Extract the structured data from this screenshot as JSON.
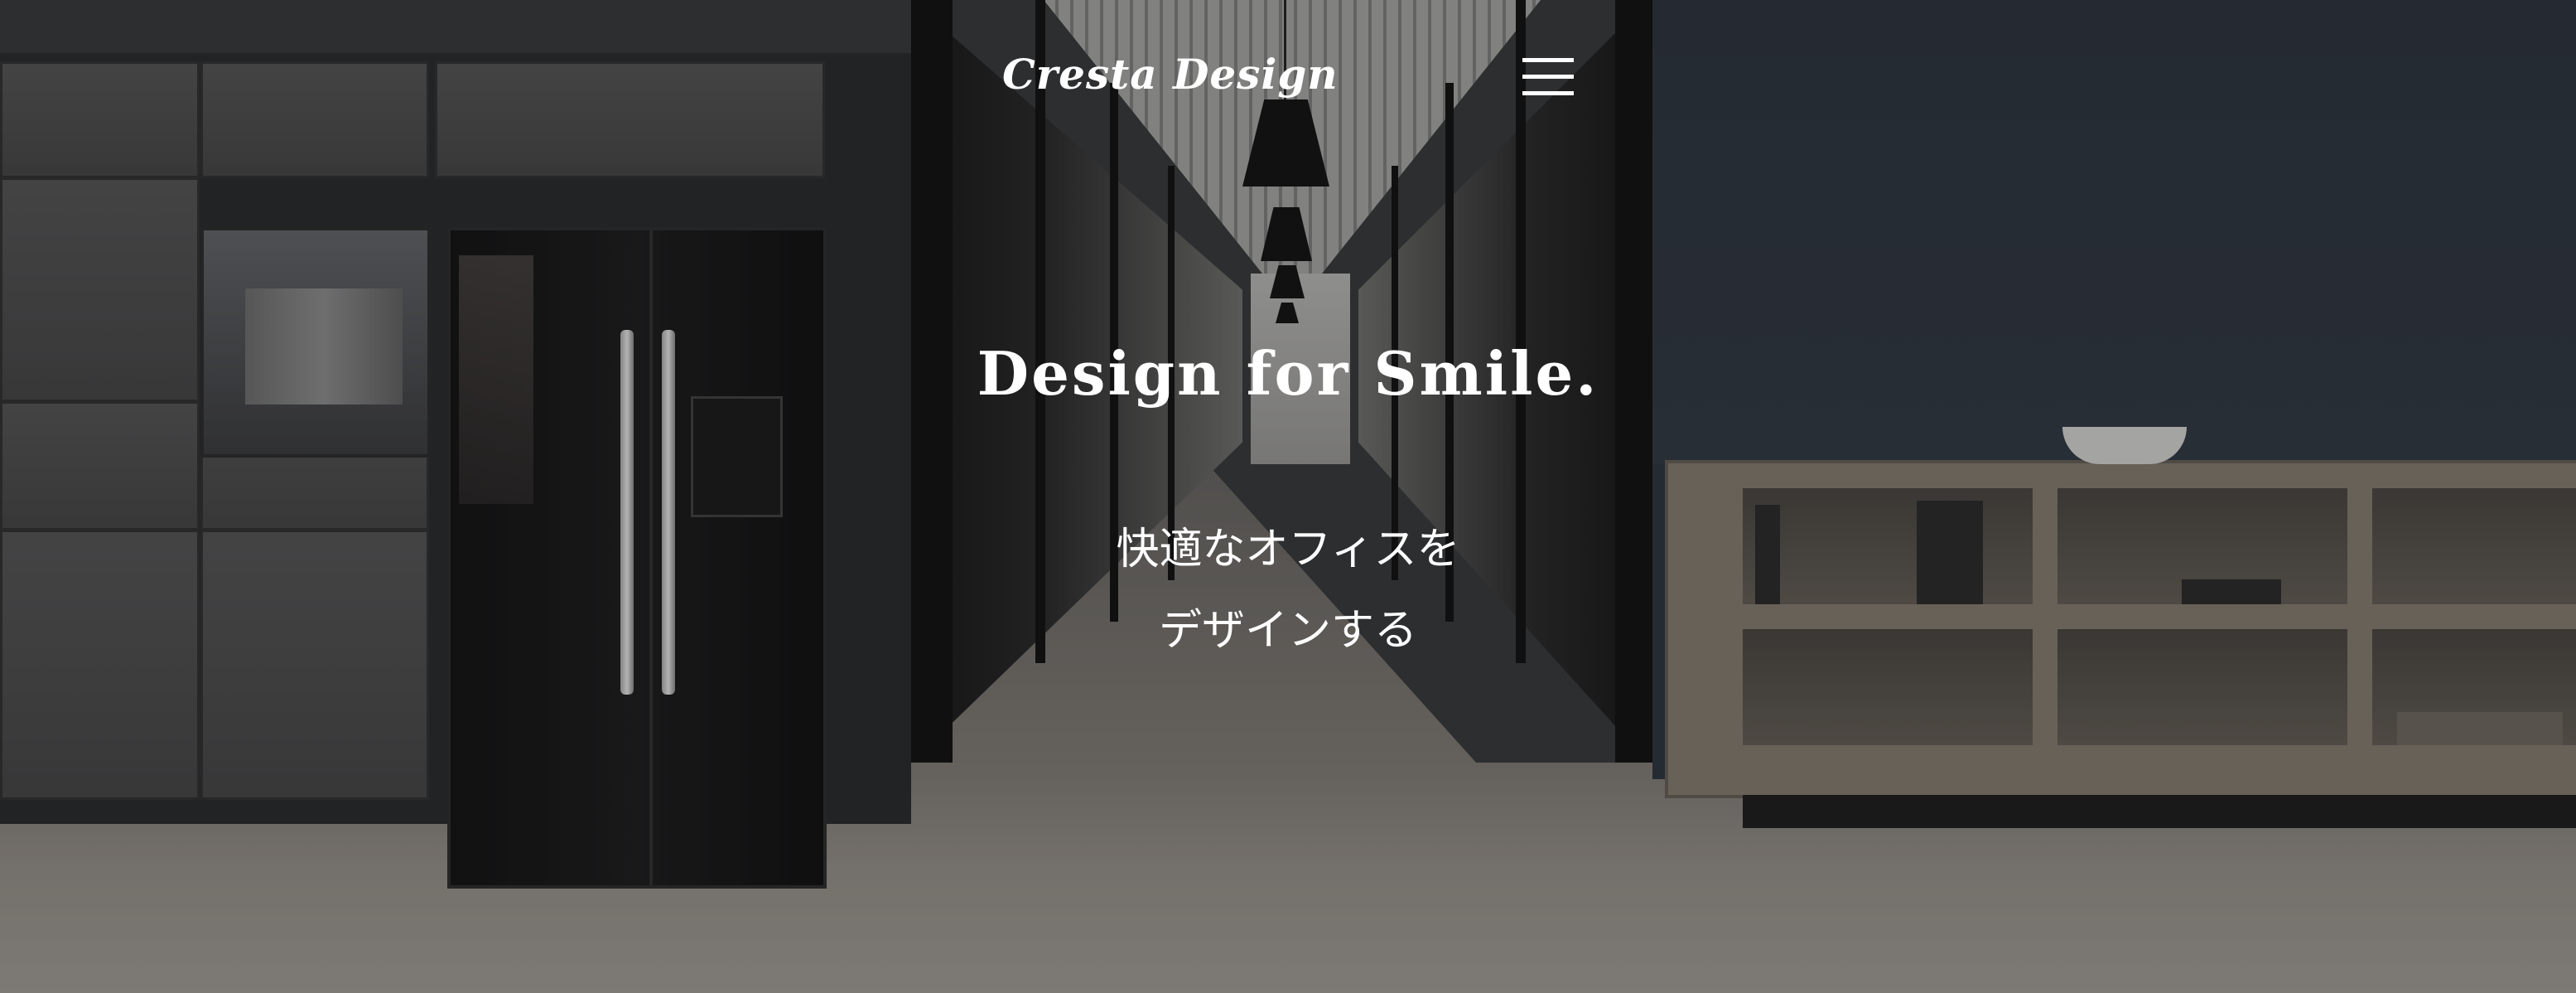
{
  "header": {
    "logo_text": "Cresta Design",
    "menu_icon": "hamburger-menu-icon"
  },
  "hero": {
    "headline": "Design for Smile.",
    "subline_1": "快適なオフィスを",
    "subline_2": "デザインする",
    "background": "office-corridor-photo"
  },
  "colors": {
    "text": "#ffffff",
    "accent_wall": "#2e3640"
  }
}
